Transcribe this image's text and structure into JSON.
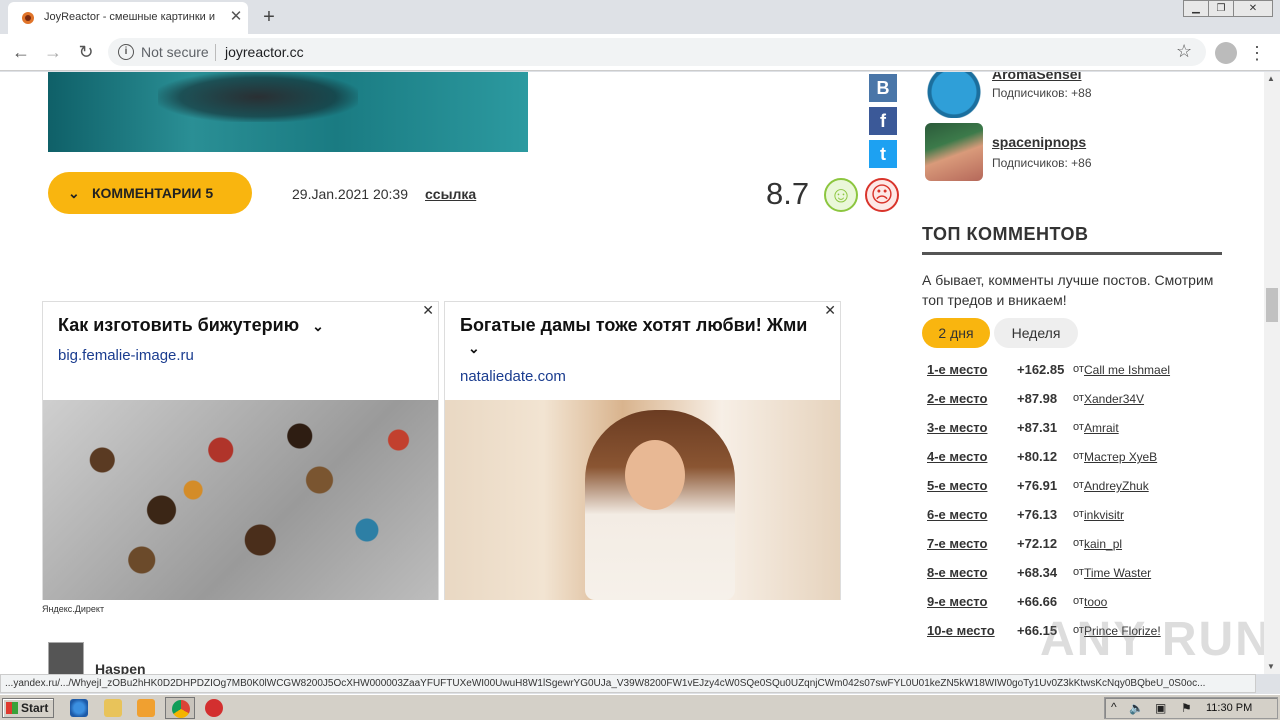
{
  "browser": {
    "tab_title": "JoyReactor - смешные картинки и",
    "tab_close": "✕",
    "new_tab": "+",
    "not_secure": "Not secure",
    "url": "joyreactor.cc",
    "win_minimize": "▁",
    "win_restore": "❐",
    "win_close": "✕"
  },
  "post": {
    "comments_label": "КОММЕНТАРИИ 5",
    "date": "29.Jan.2021 20:39",
    "link_label": "ссылка",
    "rating": "8.7",
    "share": {
      "vk": "B",
      "fb": "f",
      "tw": "t"
    }
  },
  "ads": [
    {
      "title": "Как изготовить бижутерию",
      "domain": "big.femalie-image.ru",
      "close": "✕"
    },
    {
      "title": "Богатые дамы тоже хотят любви! Жми",
      "domain": "nataliedate.com",
      "close": "✕"
    }
  ],
  "direct_label": "Яндекс.Директ",
  "comment_author": "Haspen",
  "subscribers": [
    {
      "name": "AromaSensei",
      "count": "Подписчиков: +88"
    },
    {
      "name": "spacenipnops",
      "count": "Подписчиков: +86"
    }
  ],
  "top_comments": {
    "heading": "ТОП КОММЕНТОВ",
    "description": "А бывает, комменты лучше постов. Смотрим топ тредов и вникаем!",
    "tab_active": "2 дня",
    "tab_other": "Неделя",
    "from_label": "от",
    "ranks": [
      {
        "place": "1-е место",
        "score": "+162.85",
        "user": "Call me Ishmael"
      },
      {
        "place": "2-е место",
        "score": "+87.98",
        "user": "Xander34V"
      },
      {
        "place": "3-е место",
        "score": "+87.31",
        "user": "Amrait"
      },
      {
        "place": "4-е место",
        "score": "+80.12",
        "user": "Мастер ХуеВ"
      },
      {
        "place": "5-е место",
        "score": "+76.91",
        "user": "AndreyZhuk"
      },
      {
        "place": "6-е место",
        "score": "+76.13",
        "user": "inkvisitr"
      },
      {
        "place": "7-е место",
        "score": "+72.12",
        "user": "kain_pl"
      },
      {
        "place": "8-е место",
        "score": "+68.34",
        "user": "Time Waster"
      },
      {
        "place": "9-е место",
        "score": "+66.66",
        "user": "tooo"
      },
      {
        "place": "10-е место",
        "score": "+66.15",
        "user": "Prince Florize!"
      }
    ]
  },
  "status_url": "...yandex.ru/.../WhyejI_zOBu2hHK0D2DHPDZIOg7MB0K0lWCGW8200J5OcXHW000003ZaaYFUFTUXeWI00UwuH8W1lSgewrYG0UJa_V39W8200FW1vEJzy4cW0SQe0SQu0UZqnjCWm042s07swFYL0U01keZN5kW18WIW0goTy1Uv0Z3kKtwsKcNqy0BQbeU_0S0oc...",
  "watermark": "ANY RUN",
  "taskbar": {
    "start_label": "Start",
    "clock": "11:30 PM"
  }
}
